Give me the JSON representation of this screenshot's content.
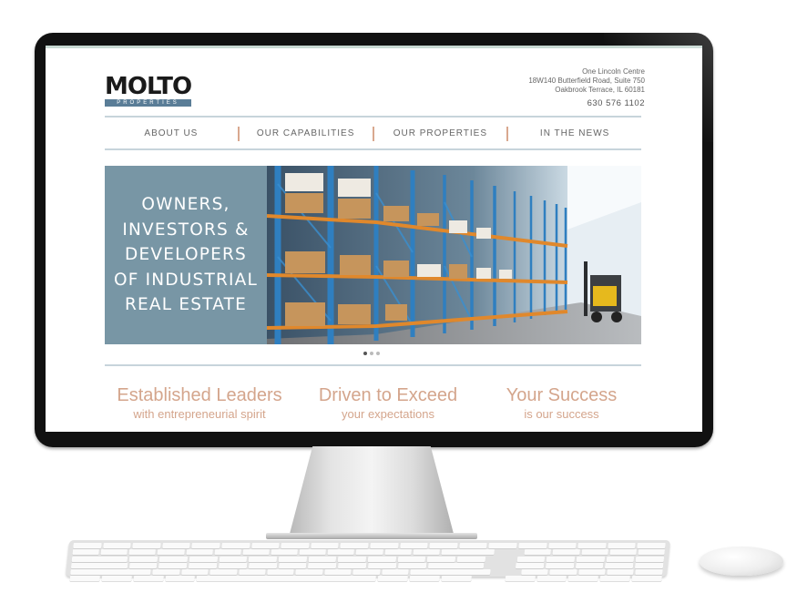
{
  "site": {
    "logo": {
      "word": "MOLTO",
      "sub": "PROPERTIES"
    },
    "address": {
      "line1": "One Lincoln Centre",
      "line2": "18W140 Butterfield Road, Suite 750",
      "line3": "Oakbrook Terrace, IL 60181",
      "phone": "630 576 1102"
    },
    "nav": [
      "ABOUT US",
      "OUR CAPABILITIES",
      "OUR PROPERTIES",
      "IN THE NEWS"
    ],
    "hero": {
      "lines": [
        "OWNERS,",
        "INVESTORS &",
        "DEVELOPERS",
        "OF INDUSTRIAL",
        "REAL ESTATE"
      ],
      "slides_total": 3,
      "slide_active": 1
    },
    "taglines": [
      {
        "head": "Established Leaders",
        "sub": "with entrepreneurial spirit"
      },
      {
        "head": "Driven to Exceed",
        "sub": "your expectations"
      },
      {
        "head": "Your Success",
        "sub": "is our success"
      }
    ]
  },
  "colors": {
    "accent": "#d4a58c",
    "hero_panel": "#7896a5",
    "logo_bar": "#5a7d97",
    "rule": "#c7d4db",
    "rack_blue": "#2f7fc0",
    "rack_orange": "#e0882c"
  }
}
